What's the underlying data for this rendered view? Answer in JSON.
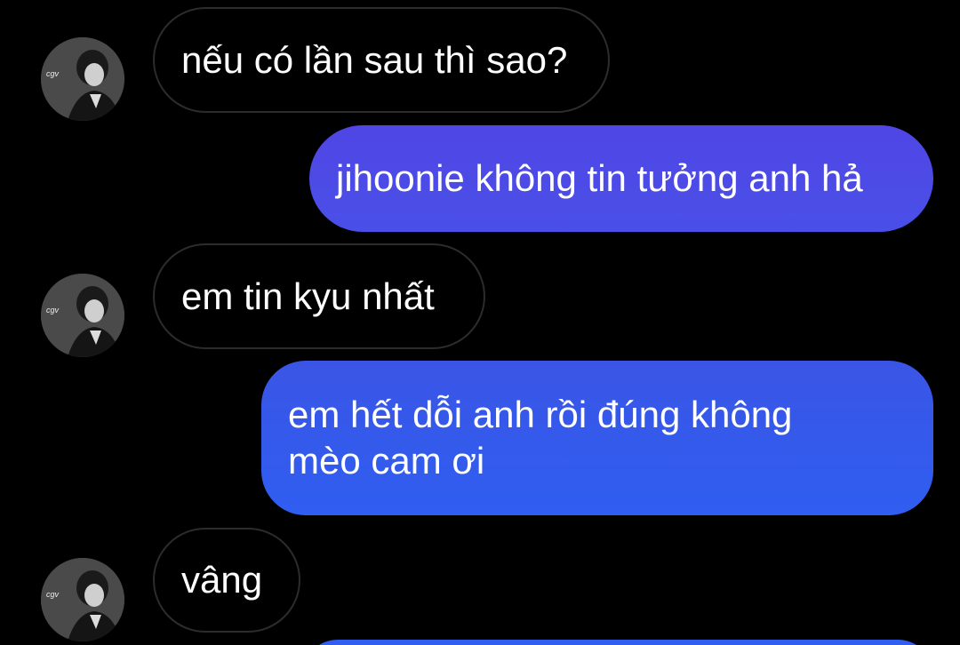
{
  "conversation": {
    "messages": [
      {
        "side": "incoming",
        "text": "nếu có lần sau thì sao?"
      },
      {
        "side": "outgoing",
        "text": "jihoonie không tin tưởng anh hả"
      },
      {
        "side": "incoming",
        "text": "em tin kyu nhất"
      },
      {
        "side": "outgoing",
        "lines": [
          "em hết dỗi anh rồi đúng không",
          "mèo cam ơi"
        ]
      },
      {
        "side": "incoming",
        "text": "vâng"
      }
    ]
  },
  "colors": {
    "background": "#000000",
    "incoming_bubble_border": "#2c2c2c",
    "outgoing_gradient_top": "#4f46e5",
    "outgoing_gradient_bottom": "#2f5ef0"
  },
  "icons": {
    "avatar": "contact-avatar-photo"
  }
}
